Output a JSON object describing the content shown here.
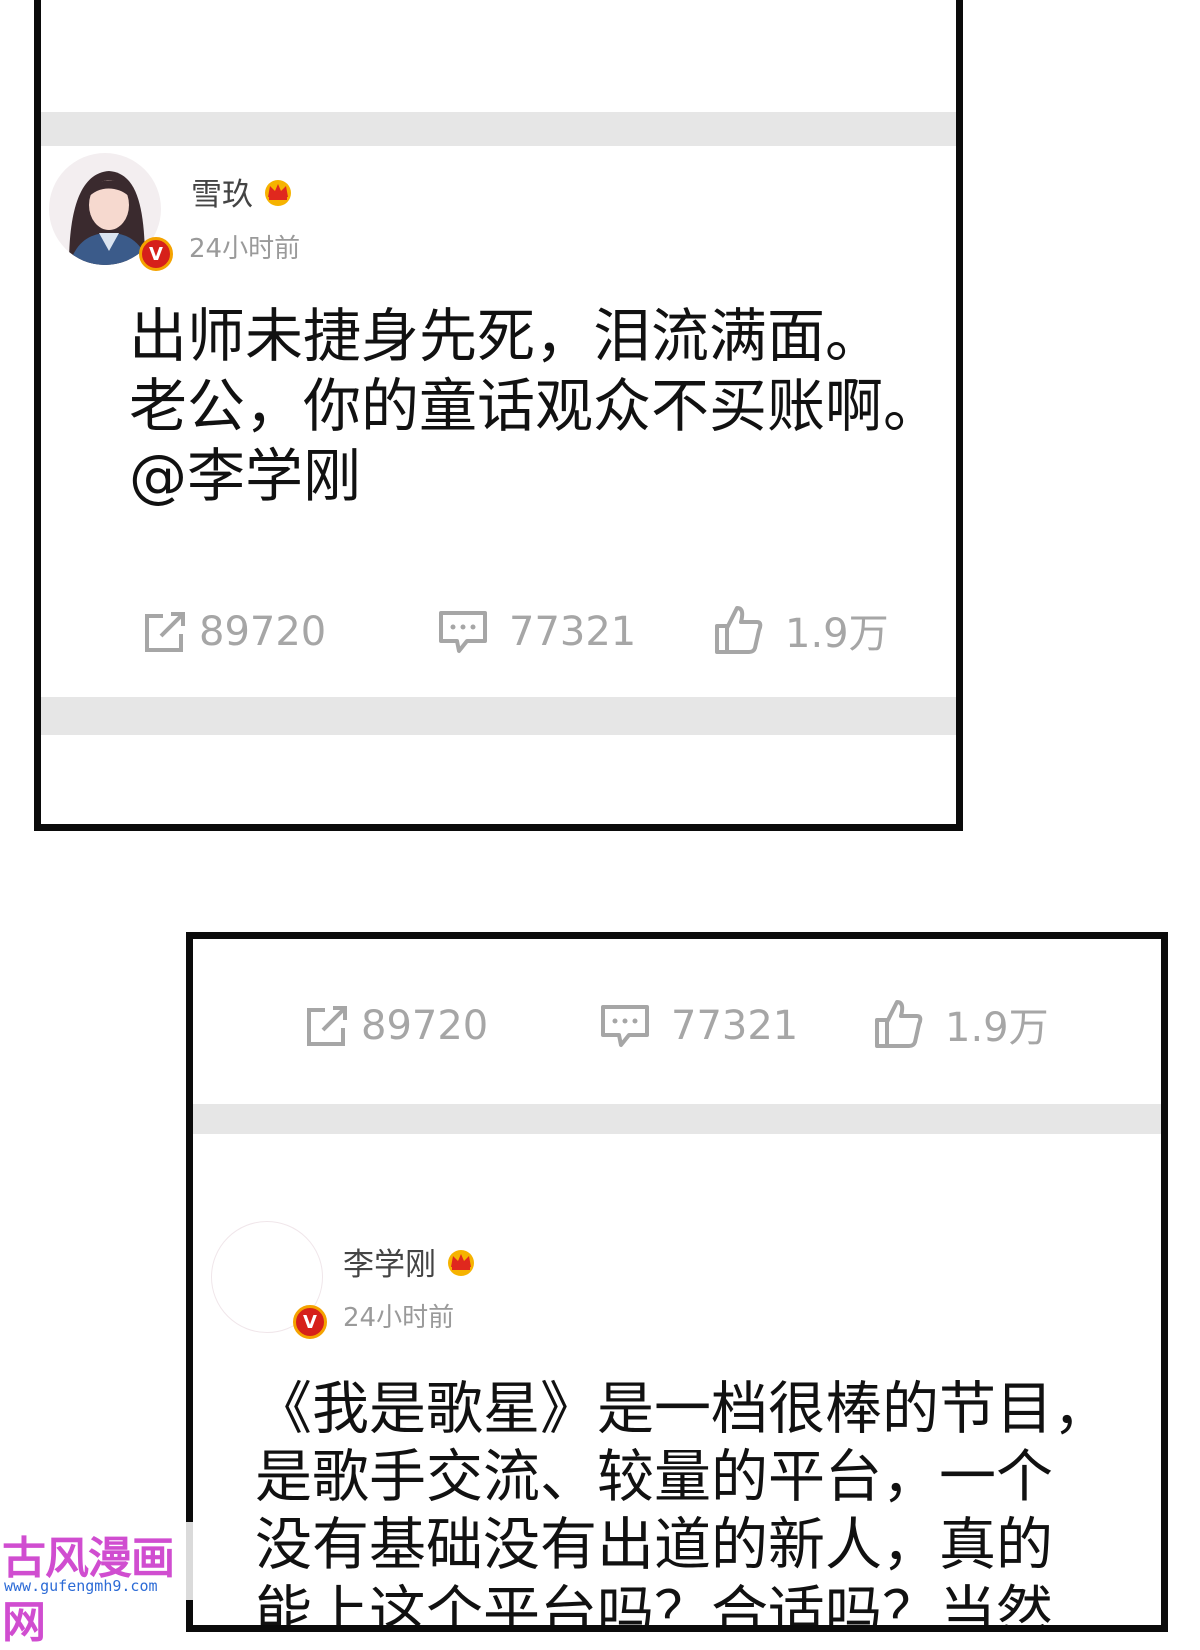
{
  "post1": {
    "username": "雪玖",
    "time": "24小时前",
    "badge": "V",
    "lines": [
      "出师未捷身先死，泪流满面。",
      "老公，你的童话观众不买账啊。",
      "@李学刚"
    ],
    "actions": {
      "repost": "89720",
      "comment": "77321",
      "like": "1.9万"
    }
  },
  "post2": {
    "actions": {
      "repost": "89720",
      "comment": "77321",
      "like": "1.9万"
    },
    "username": "李学刚",
    "time": "24小时前",
    "badge": "V",
    "lines": [
      "《我是歌星》是一档很棒的节目，",
      "是歌手交流、较量的平台，一个",
      "没有基础没有出道的新人，真的",
      "能上这个平台吗？合适吗？当然"
    ]
  },
  "watermark": {
    "title": "古风漫画网",
    "url": "www.gufengmh9.com"
  },
  "colors": {
    "separator": "#e6e6e6",
    "action_gray": "#a6a6a6",
    "verified_red": "#d6201a",
    "watermark_pink": "#d04dd0"
  }
}
